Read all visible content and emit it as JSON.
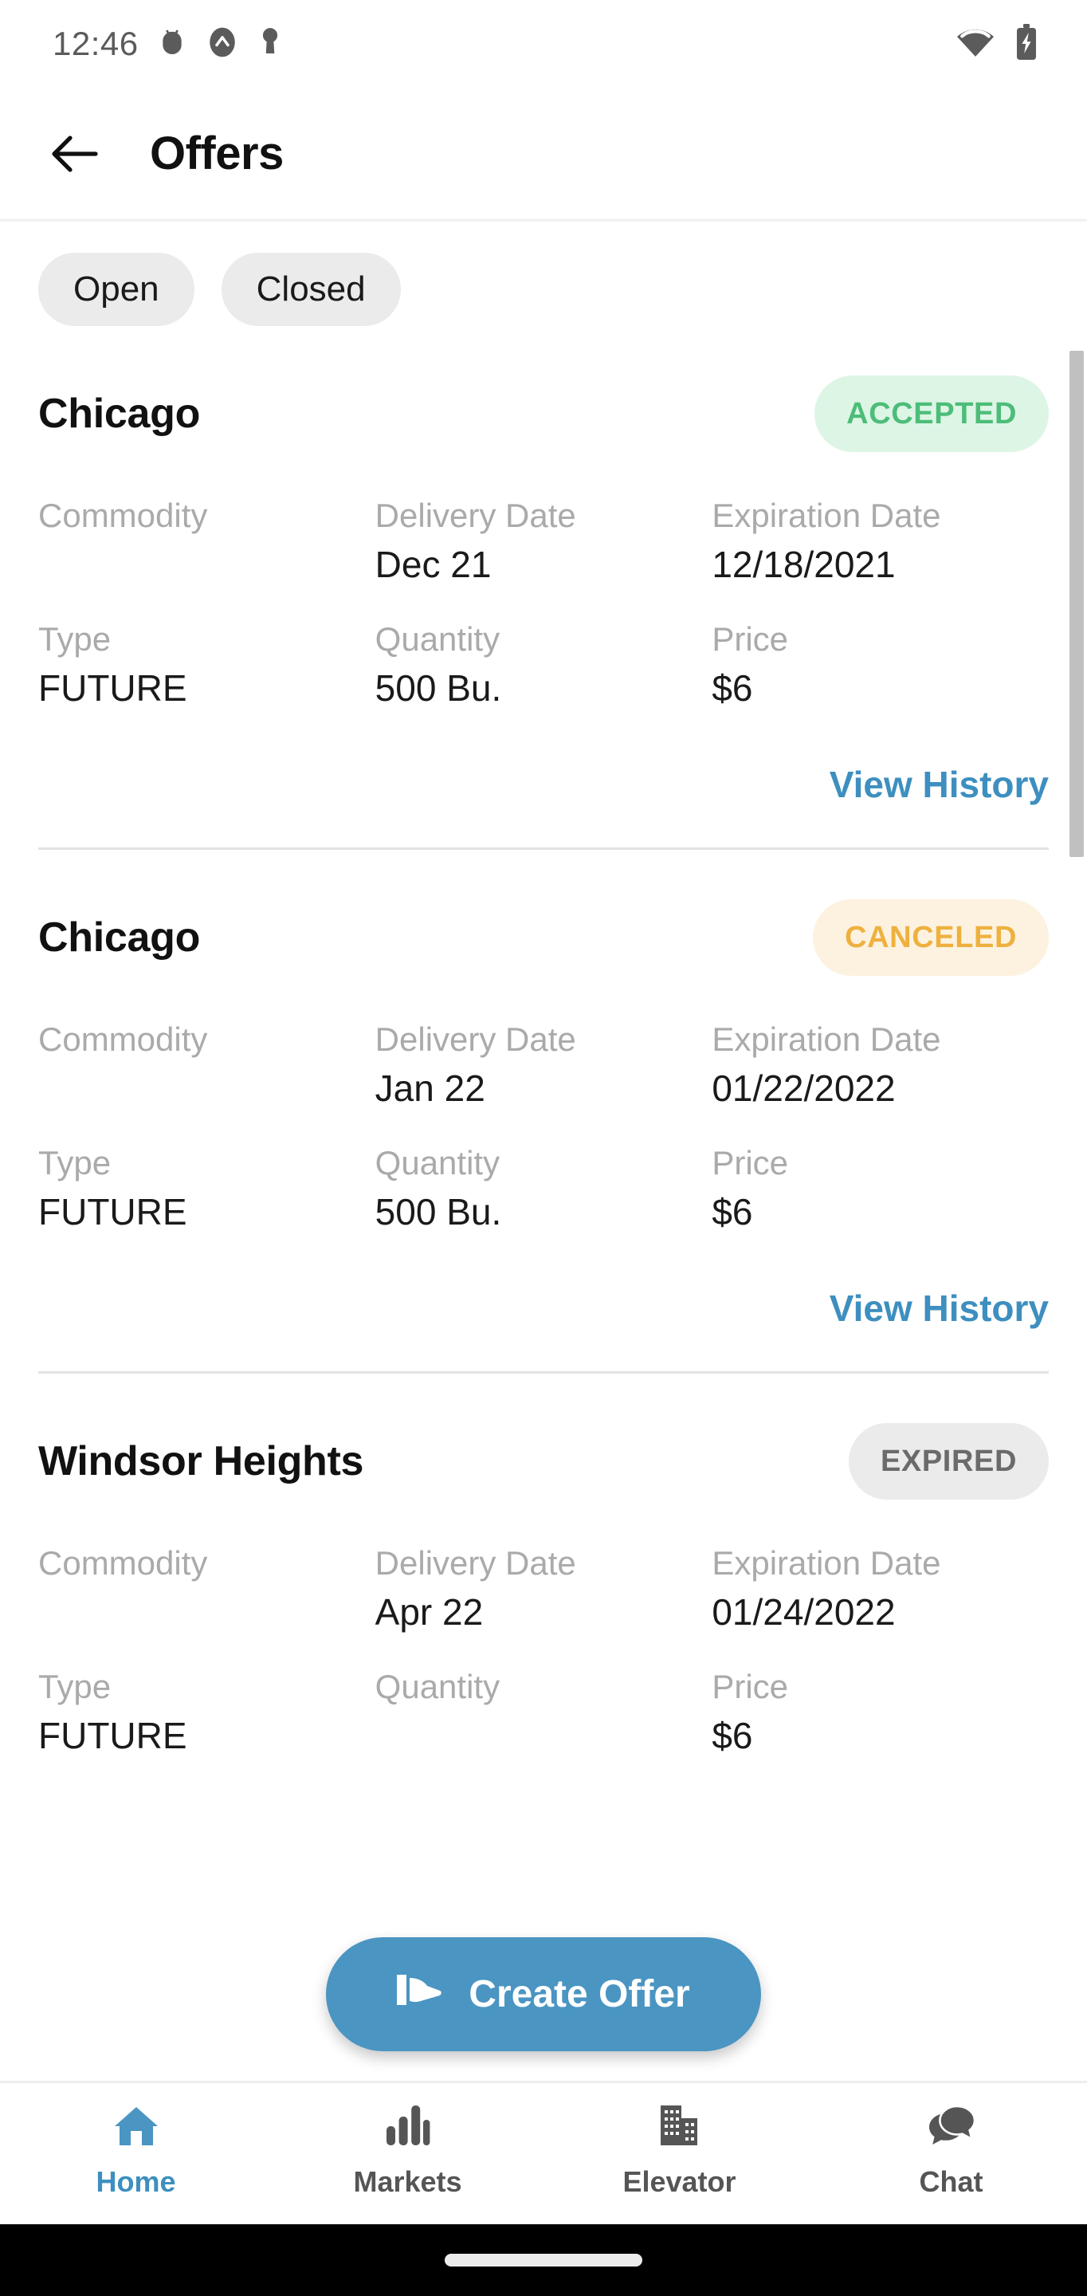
{
  "status_bar": {
    "time": "12:46",
    "left_icons": [
      "debug-bug-icon",
      "circle-chevron-up-icon",
      "key-hole-icon"
    ],
    "right_icons": [
      "wifi-icon",
      "battery-charging-icon"
    ]
  },
  "app_bar": {
    "back_icon": "arrow-left-icon",
    "title": "Offers"
  },
  "filters": {
    "chips": [
      {
        "label": "Open",
        "selected": false
      },
      {
        "label": "Closed",
        "selected": false
      }
    ]
  },
  "labels": {
    "commodity": "Commodity",
    "delivery_date": "Delivery Date",
    "expiration_date": "Expiration Date",
    "type": "Type",
    "quantity": "Quantity",
    "price": "Price",
    "view_history": "View History"
  },
  "offers": [
    {
      "location": "Chicago",
      "status": "ACCEPTED",
      "status_kind": "accepted",
      "commodity": "",
      "delivery_date": "Dec 21",
      "expiration_date": "12/18/2021",
      "type": "FUTURE",
      "quantity": "500 Bu.",
      "price": "$6"
    },
    {
      "location": "Chicago",
      "status": "CANCELED",
      "status_kind": "canceled",
      "commodity": "",
      "delivery_date": "Jan 22",
      "expiration_date": "01/22/2022",
      "type": "FUTURE",
      "quantity": "500 Bu.",
      "price": "$6"
    },
    {
      "location": "Windsor Heights",
      "status": "EXPIRED",
      "status_kind": "expired",
      "commodity": "",
      "delivery_date": "Apr 22",
      "expiration_date": "01/24/2022",
      "type": "FUTURE",
      "quantity": "",
      "price": "$6"
    }
  ],
  "fab": {
    "label": "Create Offer",
    "icon": "offer-hand-icon"
  },
  "bottom_nav": {
    "items": [
      {
        "label": "Home",
        "icon": "home-icon",
        "active": true
      },
      {
        "label": "Markets",
        "icon": "bar-chart-icon",
        "active": false
      },
      {
        "label": "Elevator",
        "icon": "building-icon",
        "active": false
      },
      {
        "label": "Chat",
        "icon": "chat-bubbles-icon",
        "active": false
      }
    ]
  },
  "colors": {
    "accent_blue": "#3d8fbf",
    "fab_blue": "#4a95c2",
    "accepted_bg": "#ddf5e5",
    "accepted_fg": "#4cbd78",
    "canceled_bg": "#fdf2e0",
    "canceled_fg": "#eeb13f",
    "expired_bg": "#ebebeb",
    "expired_fg": "#6b6b6b",
    "chip_bg": "#ebebeb",
    "label_gray": "#aaaaaa"
  }
}
